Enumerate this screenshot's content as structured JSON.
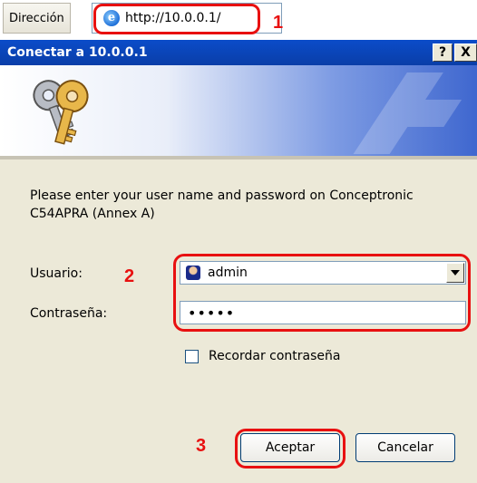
{
  "address_bar": {
    "label": "Dirección",
    "url": "http://10.0.0.1/",
    "icon": "internet-explorer-icon"
  },
  "annotations": {
    "step1": "1",
    "step2": "2",
    "step3": "3",
    "highlight_color": "#e81010"
  },
  "dialog": {
    "title": "Conectar a 10.0.0.1",
    "help_button": "?",
    "close_button": "X",
    "banner_icon": "keys-icon",
    "prompt": "Please enter your user name and password on Conceptronic C54APRA (Annex A)",
    "username_label": "Usuario:",
    "username_value": "admin",
    "username_icon": "user-icon",
    "password_label": "Contraseña:",
    "password_value": "•••••",
    "remember_label": "Recordar contraseña",
    "remember_checked": false,
    "ok_button": "Aceptar",
    "cancel_button": "Cancelar"
  }
}
